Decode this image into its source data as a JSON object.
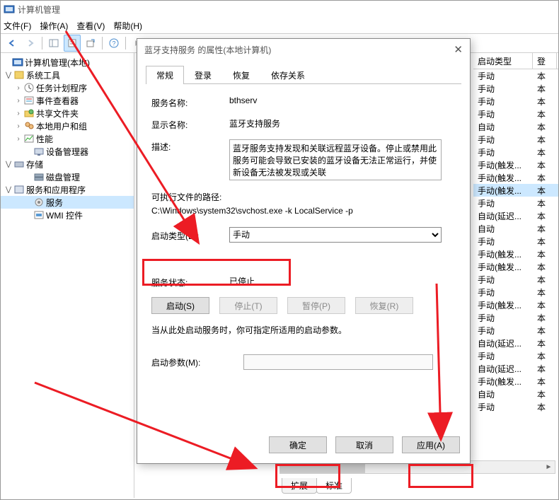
{
  "app": {
    "title": "计算机管理"
  },
  "menu": {
    "file": "文件(F)",
    "action": "操作(A)",
    "view": "查看(V)",
    "help": "帮助(H)"
  },
  "tree": {
    "root": "计算机管理(本地)",
    "system_tools": "系统工具",
    "task_scheduler": "任务计划程序",
    "event_viewer": "事件查看器",
    "shared_folders": "共享文件夹",
    "local_users": "本地用户和组",
    "performance": "性能",
    "device_manager": "设备管理器",
    "storage": "存储",
    "disk_mgmt": "磁盘管理",
    "services_apps": "服务和应用程序",
    "services": "服务",
    "wmi": "WMI 控件"
  },
  "grid": {
    "col_startup": "启动类型",
    "col_logon_initial": "登",
    "rows": [
      {
        "t": "手动",
        "x": "本"
      },
      {
        "t": "手动",
        "x": "本"
      },
      {
        "t": "手动",
        "x": "本"
      },
      {
        "t": "手动",
        "x": "本"
      },
      {
        "t": "自动",
        "x": "本"
      },
      {
        "t": "手动",
        "x": "本"
      },
      {
        "t": "手动",
        "x": "本"
      },
      {
        "t": "手动(触发...",
        "x": "本"
      },
      {
        "t": "手动(触发...",
        "x": "本"
      },
      {
        "t": "手动(触发...",
        "x": "本",
        "sel": true
      },
      {
        "t": "手动",
        "x": "本"
      },
      {
        "t": "自动(延迟...",
        "x": "本"
      },
      {
        "t": "自动",
        "x": "本"
      },
      {
        "t": "手动",
        "x": "本"
      },
      {
        "t": "手动(触发...",
        "x": "本"
      },
      {
        "t": "手动(触发...",
        "x": "本"
      },
      {
        "t": "手动",
        "x": "本"
      },
      {
        "t": "手动",
        "x": "本"
      },
      {
        "t": "手动(触发...",
        "x": "本"
      },
      {
        "t": "手动",
        "x": "本"
      },
      {
        "t": "手动",
        "x": "本"
      },
      {
        "t": "自动(延迟...",
        "x": "本"
      },
      {
        "t": "手动",
        "x": "本"
      },
      {
        "t": "自动(延迟...",
        "x": "本"
      },
      {
        "t": "手动(触发...",
        "x": "本"
      },
      {
        "t": "自动",
        "x": "本"
      },
      {
        "t": "手动",
        "x": "本"
      }
    ]
  },
  "bottom_tabs": {
    "extended": "扩展",
    "standard": "标准"
  },
  "dialog": {
    "title": "蓝牙支持服务 的属性(本地计算机)",
    "tabs": {
      "general": "常规",
      "logon": "登录",
      "recovery": "恢复",
      "deps": "依存关系"
    },
    "labels": {
      "service_name": "服务名称:",
      "display_name": "显示名称:",
      "description": "描述:",
      "exe_path": "可执行文件的路径:",
      "startup_type": "启动类型(E):",
      "service_status": "服务状态:",
      "hint": "当从此处启动服务时，你可指定所适用的启动参数。",
      "start_params": "启动参数(M):"
    },
    "values": {
      "service_name": "bthserv",
      "display_name": "蓝牙支持服务",
      "description": "蓝牙服务支持发现和关联远程蓝牙设备。停止或禁用此服务可能会导致已安装的蓝牙设备无法正常运行，并使新设备无法被发现或关联",
      "exe_path": "C:\\Windows\\system32\\svchost.exe -k LocalService -p",
      "startup_sel": "手动",
      "status": "已停止",
      "params": ""
    },
    "buttons": {
      "start": "启动(S)",
      "stop": "停止(T)",
      "pause": "暂停(P)",
      "resume": "恢复(R)",
      "ok": "确定",
      "cancel": "取消",
      "apply": "应用(A)"
    }
  }
}
